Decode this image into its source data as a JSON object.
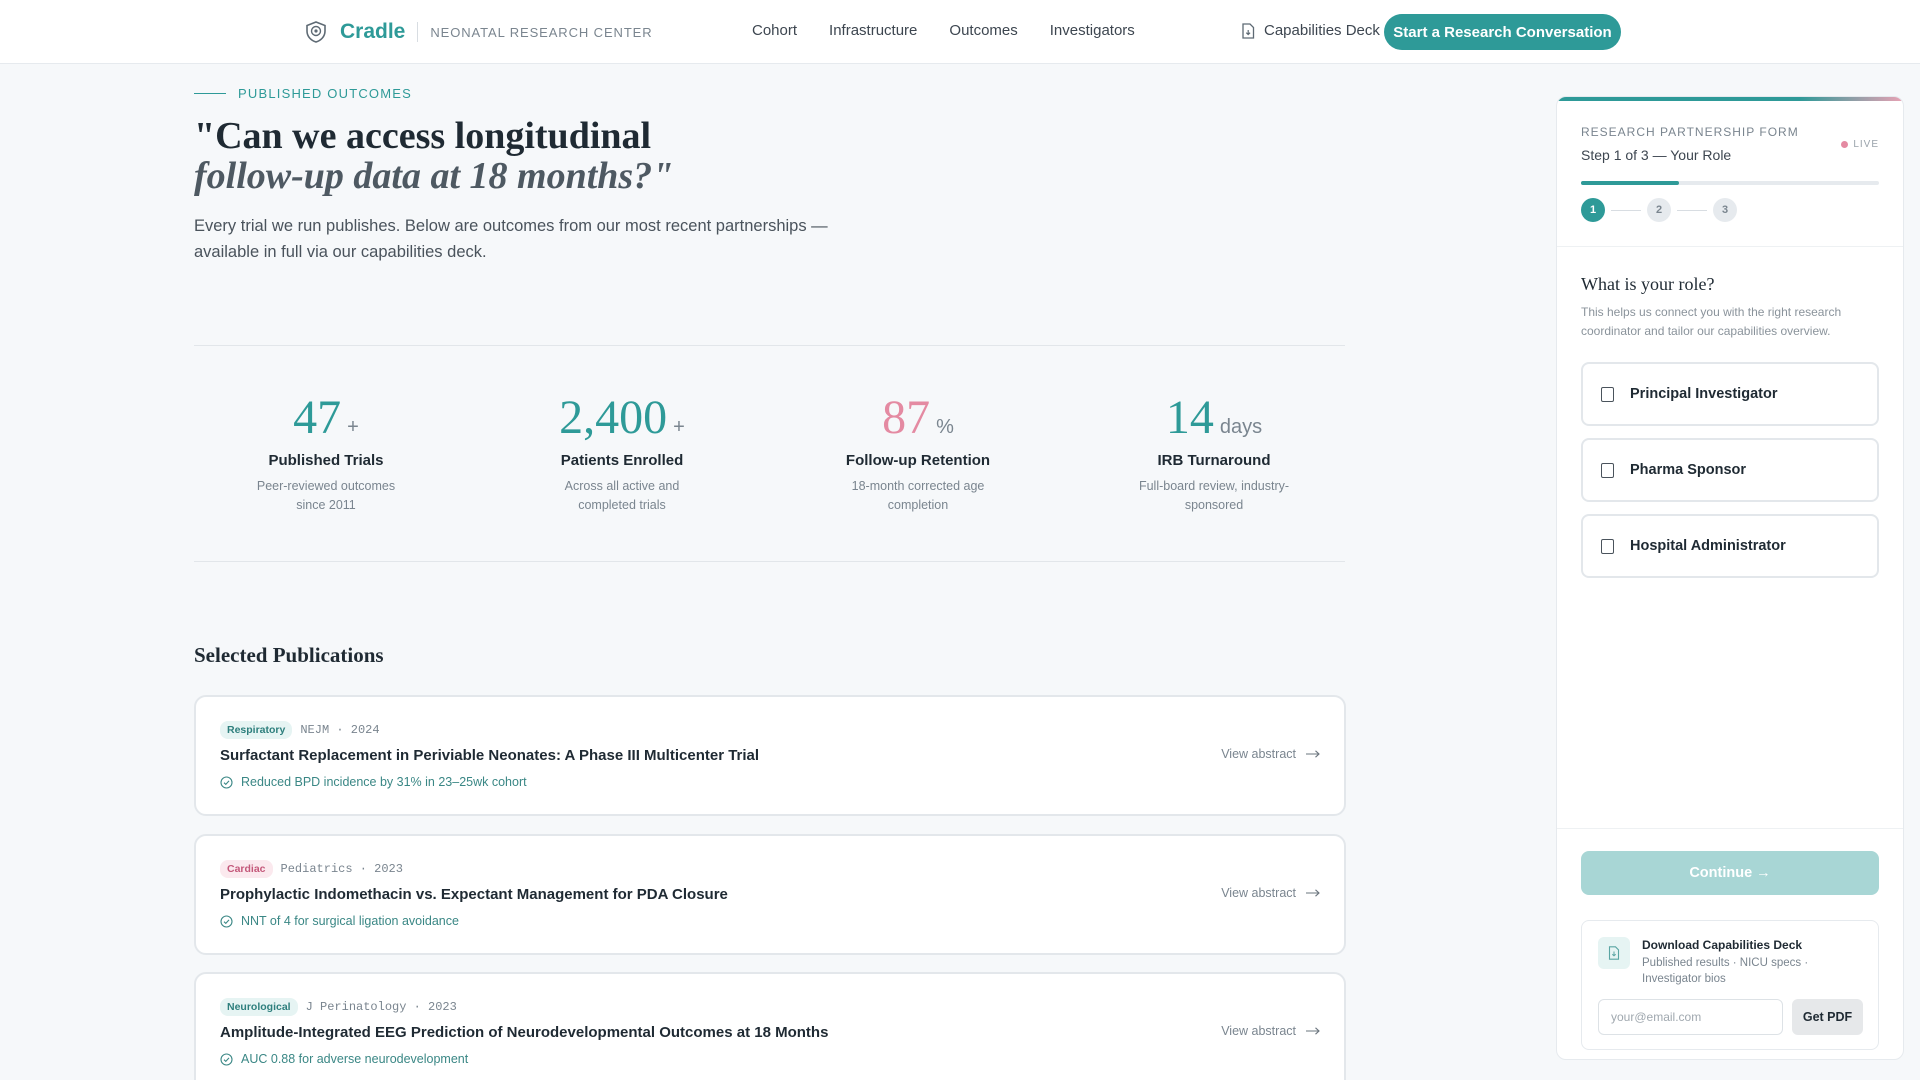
{
  "header": {
    "brand_name": "Cradle",
    "brand_sub": "NEONATAL RESEARCH CENTER",
    "nav": [
      "Cohort",
      "Infrastructure",
      "Outcomes",
      "Investigators"
    ],
    "deck_link": "Capabilities Deck",
    "cta": "Start a Research Conversation"
  },
  "hero": {
    "eyebrow": "PUBLISHED OUTCOMES",
    "question_line1": "\"Can we access longitudinal",
    "question_line2": "follow-up data at 18 months?\"",
    "description": "Every trial we run publishes. Below are outcomes from our most recent partnerships — available in full via our capabilities deck."
  },
  "stats": [
    {
      "value": "47",
      "suffix": "+",
      "label": "Published Trials",
      "desc": "Peer-reviewed outcomes since 2011"
    },
    {
      "value": "2,400",
      "suffix": "+",
      "label": "Patients Enrolled",
      "desc": "Across all active and completed trials"
    },
    {
      "value": "87",
      "suffix": "%",
      "label": "Follow-up Retention",
      "desc": "18-month corrected age completion"
    },
    {
      "value": "14",
      "suffix": "days",
      "label": "IRB Turnaround",
      "desc": "Full-board review, industry-sponsored"
    }
  ],
  "publications": {
    "title": "Selected Publications",
    "view_label": "View abstract",
    "items": [
      {
        "tag": "Respiratory",
        "journal": "NEJM · 2024",
        "title": "Surfactant Replacement in Periviable Neonates: A Phase III Multicenter Trial",
        "outcome": "Reduced BPD incidence by 31% in 23–25wk cohort"
      },
      {
        "tag": "Cardiac",
        "journal": "Pediatrics · 2023",
        "title": "Prophylactic Indomethacin vs. Expectant Management for PDA Closure",
        "outcome": "NNT of 4 for surgical ligation avoidance"
      },
      {
        "tag": "Neurological",
        "journal": "J Perinatology · 2023",
        "title": "Amplitude-Integrated EEG Prediction of Neurodevelopmental Outcomes at 18 Months",
        "outcome": "AUC 0.88 for adverse neurodevelopment"
      }
    ]
  },
  "form": {
    "label": "RESEARCH PARTNERSHIP FORM",
    "live": "LIVE",
    "step_text": "Step 1 of 3 — Your Role",
    "progress": 0.33,
    "steps": [
      "1",
      "2",
      "3"
    ],
    "question": "What is your role?",
    "help": "This helps us connect you with the right research coordinator and tailor our capabilities overview.",
    "roles": [
      "Principal Investigator",
      "Pharma Sponsor",
      "Hospital Administrator"
    ],
    "continue": "Continue →",
    "deck": {
      "title": "Download Capabilities Deck",
      "desc": "Published results · NICU specs · Investigator bios",
      "email_placeholder": "your@email.com",
      "button": "Get PDF"
    }
  },
  "colors": {
    "accent": "#2e9a98",
    "accent_pink": "#e48aa2",
    "background": "#f6f8fa"
  }
}
